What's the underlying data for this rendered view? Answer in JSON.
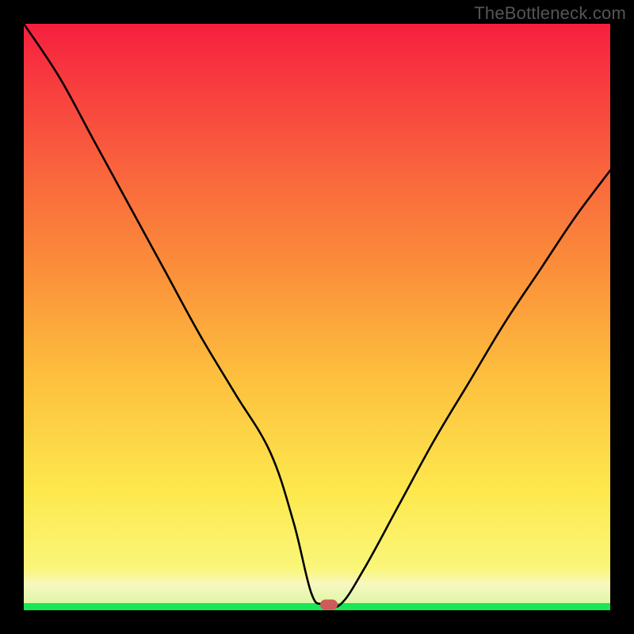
{
  "watermark": "TheBottleneck.com",
  "chart_data": {
    "type": "line",
    "title": "",
    "xlabel": "",
    "ylabel": "",
    "xlim": [
      0,
      100
    ],
    "ylim": [
      0,
      100
    ],
    "grid": false,
    "series": [
      {
        "name": "bottleneck-curve",
        "x": [
          0,
          6,
          12,
          18,
          24,
          30,
          36,
          42,
          46,
          49,
          51,
          54,
          58,
          64,
          70,
          76,
          82,
          88,
          94,
          100
        ],
        "values": [
          100,
          91,
          80,
          69,
          58,
          47,
          37,
          27,
          15,
          3,
          1,
          1,
          7,
          18,
          29,
          39,
          49,
          58,
          67,
          75
        ]
      }
    ],
    "annotations": [
      {
        "name": "optimal-marker",
        "x": 52,
        "y": 1
      }
    ],
    "background": {
      "type": "vertical-gradient",
      "stops": [
        {
          "pos": 0,
          "color": "#18e858"
        },
        {
          "pos": 1.2,
          "color": "#dff7a8"
        },
        {
          "pos": 4.5,
          "color": "#f7f7c0"
        },
        {
          "pos": 7,
          "color": "#faf67a"
        },
        {
          "pos": 20,
          "color": "#fde94e"
        },
        {
          "pos": 40,
          "color": "#fdbf3e"
        },
        {
          "pos": 58,
          "color": "#fb8f3a"
        },
        {
          "pos": 75,
          "color": "#f9643d"
        },
        {
          "pos": 92,
          "color": "#f7363f"
        },
        {
          "pos": 100,
          "color": "#f61f3d"
        }
      ]
    }
  }
}
